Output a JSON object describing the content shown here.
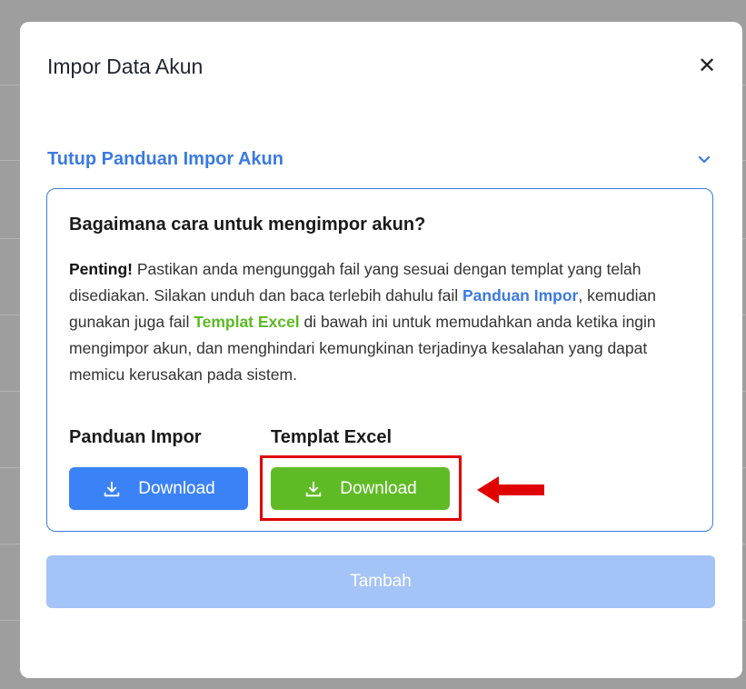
{
  "modal": {
    "title": "Impor Data Akun",
    "close_icon": "close-icon"
  },
  "guide": {
    "toggle_label": "Tutup Panduan Impor Akun",
    "heading": "Bagaimana cara untuk mengimpor akun?",
    "text_lead": "Penting!",
    "text_1": " Pastikan anda mengunggah fail yang sesuai dengan templat yang telah disediakan. Silakan unduh dan baca terlebih dahulu fail ",
    "link_guide": "Panduan Impor",
    "text_2": ", kemudian gunakan juga fail ",
    "link_template": "Templat Excel",
    "text_3": " di bawah ini untuk memudahkan anda ketika ingin mengimpor akun, dan menghindari kemungkinan terjadinya kesalahan yang dapat memicu kerusakan pada sistem."
  },
  "downloads": {
    "guide_label": "Panduan Impor",
    "template_label": "Templat Excel",
    "guide_button": "Download",
    "template_button": "Download",
    "icon": "download-icon"
  },
  "submit_label": "Tambah",
  "colors": {
    "accent_blue": "#3b82f6",
    "accent_green": "#5fbb25",
    "highlight_red": "#e00000",
    "disabled_blue": "#a4c3f7"
  }
}
